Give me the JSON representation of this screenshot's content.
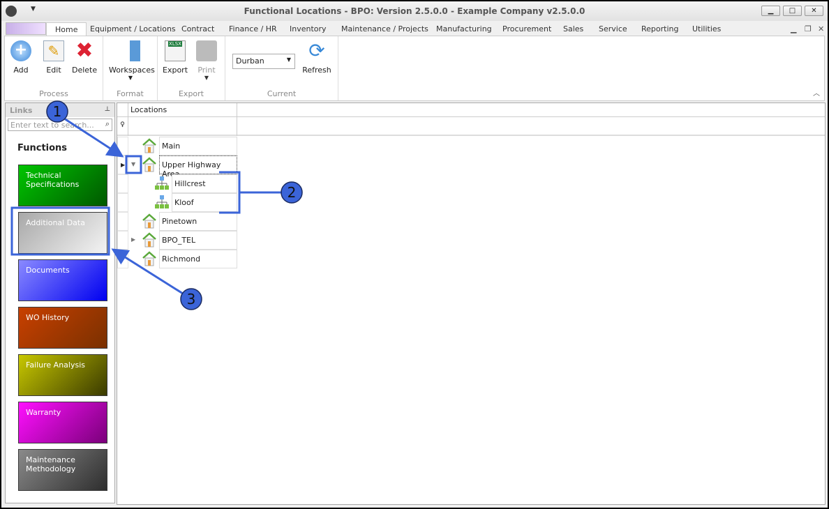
{
  "window": {
    "title": "Functional Locations - BPO: Version 2.5.0.0 - Example Company v2.5.0.0"
  },
  "tabs": [
    "Home",
    "Equipment / Locations",
    "Contract",
    "Finance / HR",
    "Inventory",
    "Maintenance / Projects",
    "Manufacturing",
    "Procurement",
    "Sales",
    "Service",
    "Reporting",
    "Utilities"
  ],
  "ribbon": {
    "process": {
      "label": "Process",
      "add": "Add",
      "edit": "Edit",
      "delete": "Delete"
    },
    "format": {
      "label": "Format",
      "workspaces": "Workspaces"
    },
    "export": {
      "label": "Export",
      "export": "Export",
      "print": "Print"
    },
    "current": {
      "label": "Current",
      "site": "Durban",
      "refresh": "Refresh"
    }
  },
  "links": {
    "title": "Links",
    "search_placeholder": "Enter text to search...",
    "functions": "Functions",
    "tiles": [
      {
        "label": "Technical Specifications",
        "colors": [
          "#00c400",
          "#005800"
        ]
      },
      {
        "label": "Additional Data",
        "colors": [
          "#a8a8a8",
          "#f4f4f4"
        ]
      },
      {
        "label": "Documents",
        "colors": [
          "#8a8aff",
          "#0000f0"
        ]
      },
      {
        "label": "WO History",
        "colors": [
          "#c84000",
          "#7a3000"
        ]
      },
      {
        "label": "Failure Analysis",
        "colors": [
          "#c8c800",
          "#3a3a00"
        ]
      },
      {
        "label": "Warranty",
        "colors": [
          "#ff10ff",
          "#7a007a"
        ]
      },
      {
        "label": "Maintenance Methodology",
        "colors": [
          "#8a8a8a",
          "#2e2e2e"
        ]
      }
    ]
  },
  "grid": {
    "column": "Locations",
    "rows": [
      {
        "label": "Main",
        "icon": "house-icon",
        "level": 0
      },
      {
        "label": "Upper Highway Area",
        "icon": "house-icon",
        "level": 0,
        "expanded": true
      },
      {
        "label": "Hillcrest",
        "icon": "hierarchy-icon",
        "level": 1
      },
      {
        "label": "Kloof",
        "icon": "hierarchy-icon",
        "level": 1
      },
      {
        "label": "Pinetown",
        "icon": "house-icon",
        "level": 0
      },
      {
        "label": "BPO_TEL",
        "icon": "house-icon",
        "level": 0,
        "expandable": true
      },
      {
        "label": "Richmond",
        "icon": "house-icon",
        "level": 0
      }
    ]
  },
  "callouts": [
    "1",
    "2",
    "3"
  ],
  "accent": "#3b64d8"
}
